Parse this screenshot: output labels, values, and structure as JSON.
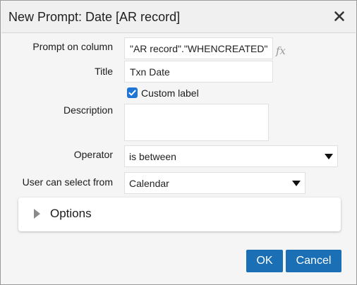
{
  "dialog": {
    "title": "New Prompt: Date [AR record]",
    "close_icon": "close-icon"
  },
  "form": {
    "prompt_on_column": {
      "label": "Prompt on column",
      "value": "\"AR record\".\"WHENCREATED\"",
      "fx_label": "fx"
    },
    "title": {
      "label": "Title",
      "value": "Txn Date"
    },
    "custom_label": {
      "label": "Custom label",
      "checked": true
    },
    "description": {
      "label": "Description",
      "value": ""
    },
    "operator": {
      "label": "Operator",
      "value": "is between"
    },
    "user_can_select_from": {
      "label": "User can select from",
      "value": "Calendar"
    }
  },
  "options": {
    "label": "Options",
    "expanded": false
  },
  "buttons": {
    "ok": "OK",
    "cancel": "Cancel"
  },
  "colors": {
    "primary_button": "#1a6fb5",
    "checkbox": "#1f75d6"
  }
}
